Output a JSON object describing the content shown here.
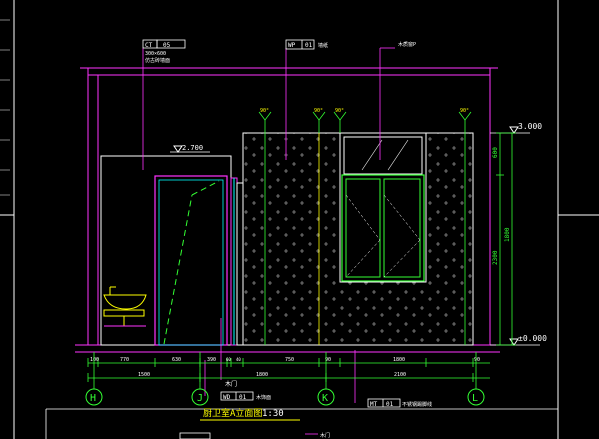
{
  "drawing": {
    "title": "厨卫室A立面图",
    "scale": "1:30",
    "levels": {
      "top": "3.000",
      "bottom": "±0.000",
      "door_top": "2.700"
    },
    "tags": {
      "ct": {
        "code": "CT",
        "num": "05",
        "note1": "300×600",
        "note2": "仿古砖墙面"
      },
      "wp": {
        "code": "WP",
        "num": "01",
        "note": "墙纸"
      },
      "window": {
        "note": "木质窗P"
      },
      "wd": {
        "code": "WD",
        "num": "01",
        "note": "木饰面"
      },
      "mt": {
        "code": "MT",
        "num": "01",
        "note": "不锈钢踢脚线"
      },
      "door": {
        "note": "木门"
      },
      "bottom_tag": {
        "note": "木门"
      }
    },
    "angles": [
      "90°",
      "90°",
      "90°",
      "90°"
    ],
    "dims_top": [
      "100",
      "770",
      "630",
      "390",
      "60",
      "40",
      "750",
      "90",
      "1800",
      "90"
    ],
    "dims_mid": [
      "1500",
      "1800",
      "2100"
    ],
    "dims_right": [
      "600",
      "2300",
      "1800"
    ],
    "axes": [
      "H",
      "J",
      "K",
      "L"
    ]
  }
}
